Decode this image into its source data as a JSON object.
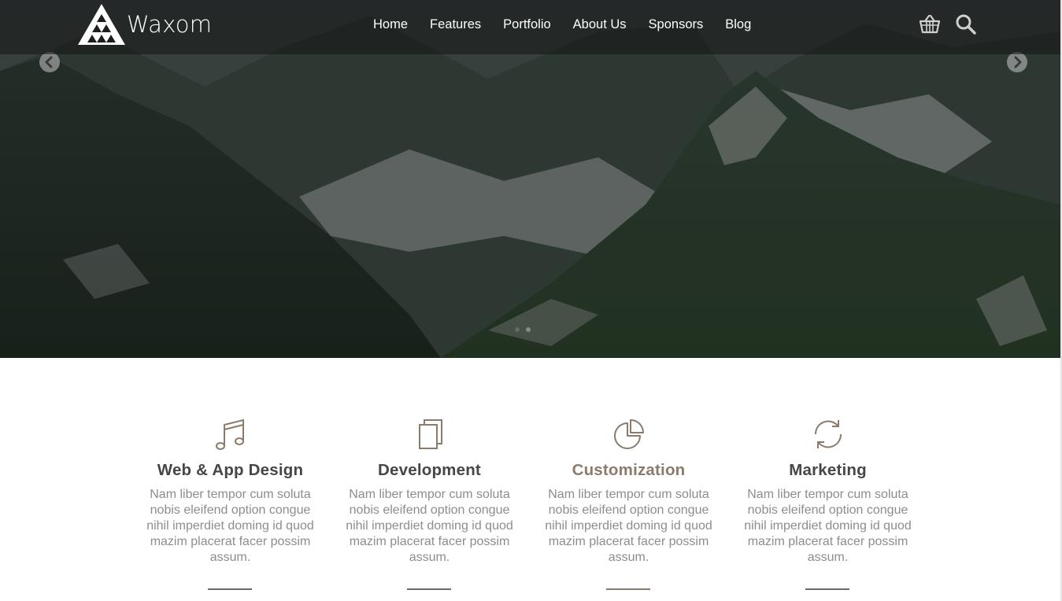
{
  "brand": {
    "name": "Waxom",
    "logo_icon": "triangle-mosaic-logo"
  },
  "nav": {
    "items": [
      "Home",
      "Features",
      "Portfolio",
      "About Us",
      "Sponsors",
      "Blog"
    ]
  },
  "header_icons": {
    "cart": "basket-icon",
    "search": "search-icon"
  },
  "slider": {
    "prev_icon": "chevron-left-icon",
    "next_icon": "chevron-right-icon",
    "dots": 2,
    "active_dot": 2
  },
  "services": [
    {
      "title": "Web & App Design",
      "text": "Nam liber tempor cum soluta nobis eleifend option congue nihil imperdiet doming id quod mazim placerat facer possim assum.",
      "icon": "music-note-icon"
    },
    {
      "title": "Development",
      "text": "Nam liber tempor cum soluta nobis eleifend option congue nihil imperdiet doming id quod mazim placerat facer possim assum.",
      "icon": "copy-pages-icon"
    },
    {
      "title": "Customization",
      "text": "Nam liber tempor cum soluta nobis eleifend option congue nihil imperdiet doming id quod mazim placerat facer possim assum.",
      "icon": "pie-chart-icon"
    },
    {
      "title": "Marketing",
      "text": "Nam liber tempor cum soluta nobis eleifend option congue nihil imperdiet doming id quod mazim placerat facer possim assum.",
      "icon": "refresh-cycle-icon"
    }
  ],
  "colors": {
    "accent": "#8c7a6b",
    "heading": "#464646",
    "body_text": "#8d8d8d"
  }
}
